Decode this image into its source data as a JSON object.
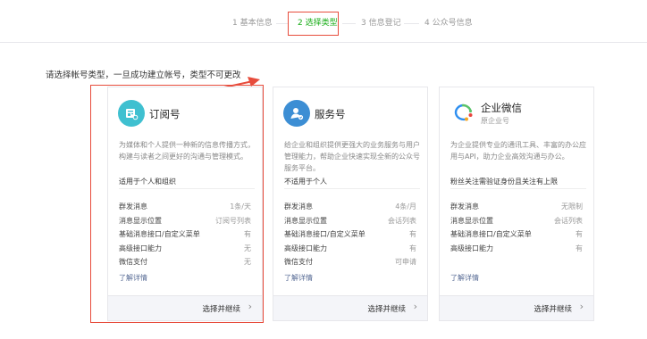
{
  "steps": [
    {
      "label": "1 基本信息"
    },
    {
      "label": "2 选择类型"
    },
    {
      "label": "3 信息登记"
    },
    {
      "label": "4 公众号信息"
    }
  ],
  "instruction": "请选择帐号类型，一旦成功建立帐号，类型不可更改",
  "colors": {
    "accent": "#1aad19",
    "highlight": "#e74c3c",
    "link": "#576b95"
  },
  "cards": [
    {
      "icon": "subscription-icon",
      "title": "订阅号",
      "description": "为媒体和个人提供一种新的信息传播方式，构建与读者之间更好的沟通与管理模式。",
      "suitable": "适用于个人和组织",
      "features": [
        {
          "name": "群发消息",
          "value": "1条/天"
        },
        {
          "name": "消息显示位置",
          "value": "订阅号列表"
        },
        {
          "name": "基础消息接口/自定义菜单",
          "value": "有"
        },
        {
          "name": "高级接口能力",
          "value": "无"
        },
        {
          "name": "微信支付",
          "value": "无"
        }
      ],
      "more": "了解详情",
      "choose": "选择并继续"
    },
    {
      "icon": "service-icon",
      "title": "服务号",
      "description": "给企业和组织提供更强大的业务服务与用户管理能力，帮助企业快速实现全新的公众号服务平台。",
      "suitable": "不适用于个人",
      "features": [
        {
          "name": "群发消息",
          "value": "4条/月"
        },
        {
          "name": "消息显示位置",
          "value": "会话列表"
        },
        {
          "name": "基础消息接口/自定义菜单",
          "value": "有"
        },
        {
          "name": "高级接口能力",
          "value": "有"
        },
        {
          "name": "微信支付",
          "value": "可申请"
        }
      ],
      "more": "了解详情",
      "choose": "选择并继续"
    },
    {
      "icon": "enterprise-wechat-icon",
      "title": "企业微信",
      "subtitle": "原企业号",
      "description": "为企业提供专业的通讯工具、丰富的办公应用与API，助力企业高效沟通与办公。",
      "suitable": "粉丝关注需验证身份且关注有上限",
      "features": [
        {
          "name": "群发消息",
          "value": "无限制"
        },
        {
          "name": "消息显示位置",
          "value": "会话列表"
        },
        {
          "name": "基础消息接口/自定义菜单",
          "value": "有"
        },
        {
          "name": "高级接口能力",
          "value": "有"
        }
      ],
      "more": "了解详情",
      "choose": "选择并继续"
    }
  ]
}
